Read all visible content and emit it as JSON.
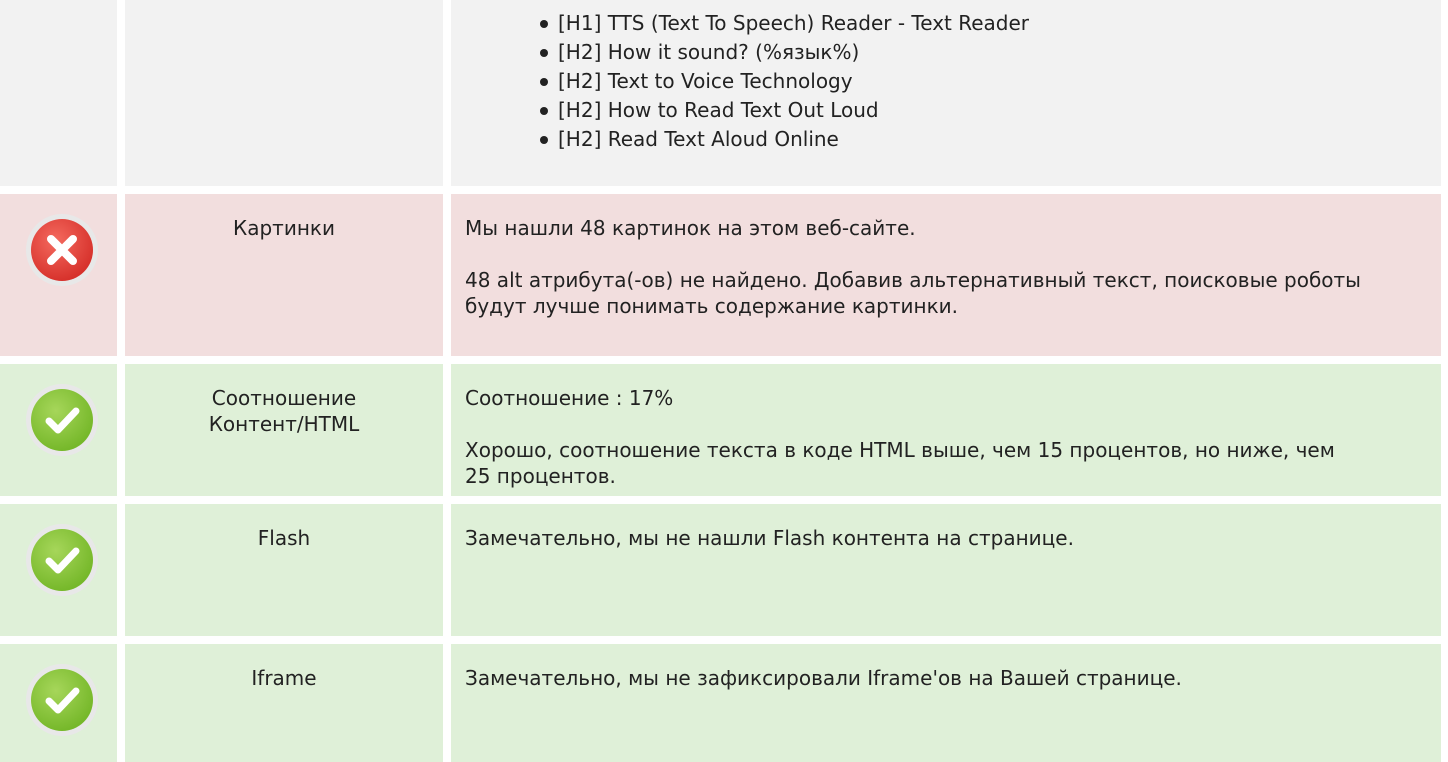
{
  "headings": [
    "[H1] TTS (Text To Speech) Reader - Text Reader",
    "[H2] How it sound? (%язык%)",
    "[H2] Text to Voice Technology",
    "[H2] How to Read Text Out Loud",
    "[H2] Read Text Aloud Online"
  ],
  "rows": {
    "images": {
      "status": "error",
      "icon": "error-x-icon",
      "label": "Картинки",
      "lines": [
        "Мы нашли 48 картинок на этом веб-сайте.",
        "48 alt атрибута(-ов) не найдено. Добавив альтернативный текст, поисковые роботы будут лучше понимать содержание картинки."
      ]
    },
    "ratio": {
      "status": "ok",
      "icon": "success-check-icon",
      "label": "Соотношение Контент/HTML",
      "lines": [
        "Соотношение : 17%",
        "Хорошо, соотношение текста в коде HTML выше, чем 15 процентов, но ниже, чем 25 процентов."
      ]
    },
    "flash": {
      "status": "ok",
      "icon": "success-check-icon",
      "label": "Flash",
      "lines": [
        "Замечательно, мы не нашли Flash контента на странице."
      ]
    },
    "iframe": {
      "status": "ok",
      "icon": "success-check-icon",
      "label": "Iframe",
      "lines": [
        "Замечательно, мы не зафиксировали Iframe'ов на Вашей странице."
      ]
    }
  },
  "colors": {
    "error_row_bg": "#f2dede",
    "ok_row_bg": "#dff0d8",
    "neutral_row_bg": "#f2f2f2",
    "error_icon": "#e2403a",
    "ok_icon": "#8cc63f"
  }
}
